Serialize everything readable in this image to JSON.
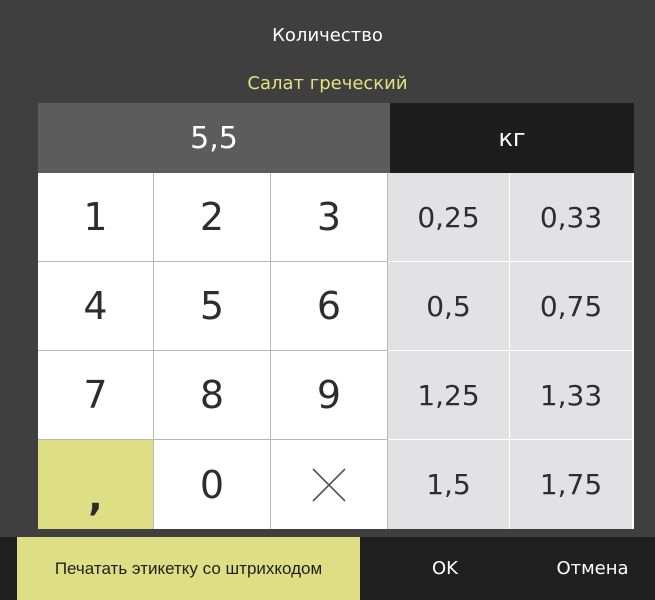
{
  "dialog": {
    "title": "Количество",
    "subtitle": "Салат греческий"
  },
  "display": {
    "value": "5,5",
    "unit": "кг"
  },
  "keypad": {
    "digits": [
      "1",
      "2",
      "3",
      "4",
      "5",
      "6",
      "7",
      "8",
      "9",
      "0"
    ],
    "comma": ",",
    "clear_icon": "clear-x-icon"
  },
  "quick_values": [
    "0,25",
    "0,33",
    "0,5",
    "0,75",
    "1,25",
    "1,33",
    "1,5",
    "1,75"
  ],
  "bottom_bar": {
    "print_label": "Печатать этикетку со штрихкодом",
    "ok_label": "OK",
    "cancel_label": "Отмена"
  },
  "colors": {
    "background": "#3e3f3e",
    "accent_yellow": "#dede85",
    "subtitle_yellow": "#e5e07f",
    "display_bg": "#5b5c5b",
    "unit_bg": "#1d1d1d",
    "quick_bg": "#e2e2e4",
    "bottom_bar_bg": "#202020"
  }
}
